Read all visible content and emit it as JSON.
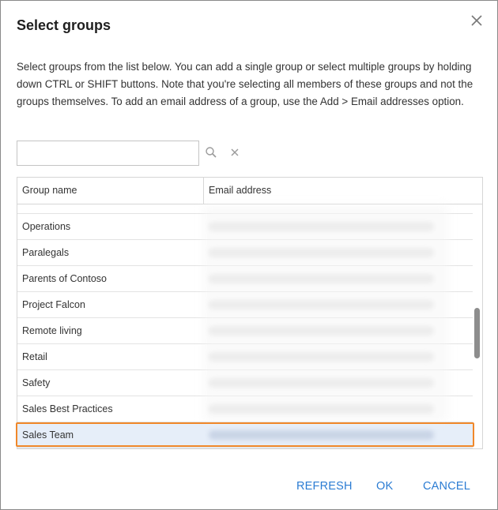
{
  "dialog": {
    "title": "Select groups",
    "description": "Select groups from the list below. You can add a single group or select multiple groups by holding down CTRL or SHIFT buttons. Note that you're selecting all members of these groups and not the groups themselves. To add an email address of a group, use the Add > Email addresses option."
  },
  "search": {
    "value": "",
    "placeholder": "",
    "search_icon": "search-icon",
    "clear_icon": "close-icon"
  },
  "table": {
    "columns": [
      "Group name",
      "Email address"
    ],
    "rows": [
      {
        "name": "Operations",
        "selected": false
      },
      {
        "name": "Paralegals",
        "selected": false
      },
      {
        "name": "Parents of Contoso",
        "selected": false
      },
      {
        "name": "Project Falcon",
        "selected": false
      },
      {
        "name": "Remote living",
        "selected": false
      },
      {
        "name": "Retail",
        "selected": false
      },
      {
        "name": "Safety",
        "selected": false
      },
      {
        "name": "Sales Best Practices",
        "selected": false
      },
      {
        "name": "Sales Team",
        "selected": true
      }
    ]
  },
  "buttons": {
    "refresh": "REFRESH",
    "ok": "OK",
    "cancel": "CANCEL"
  },
  "colors": {
    "accent": "#2b7cd3",
    "highlight": "#f0882a",
    "selected_row": "#e6eef9"
  }
}
